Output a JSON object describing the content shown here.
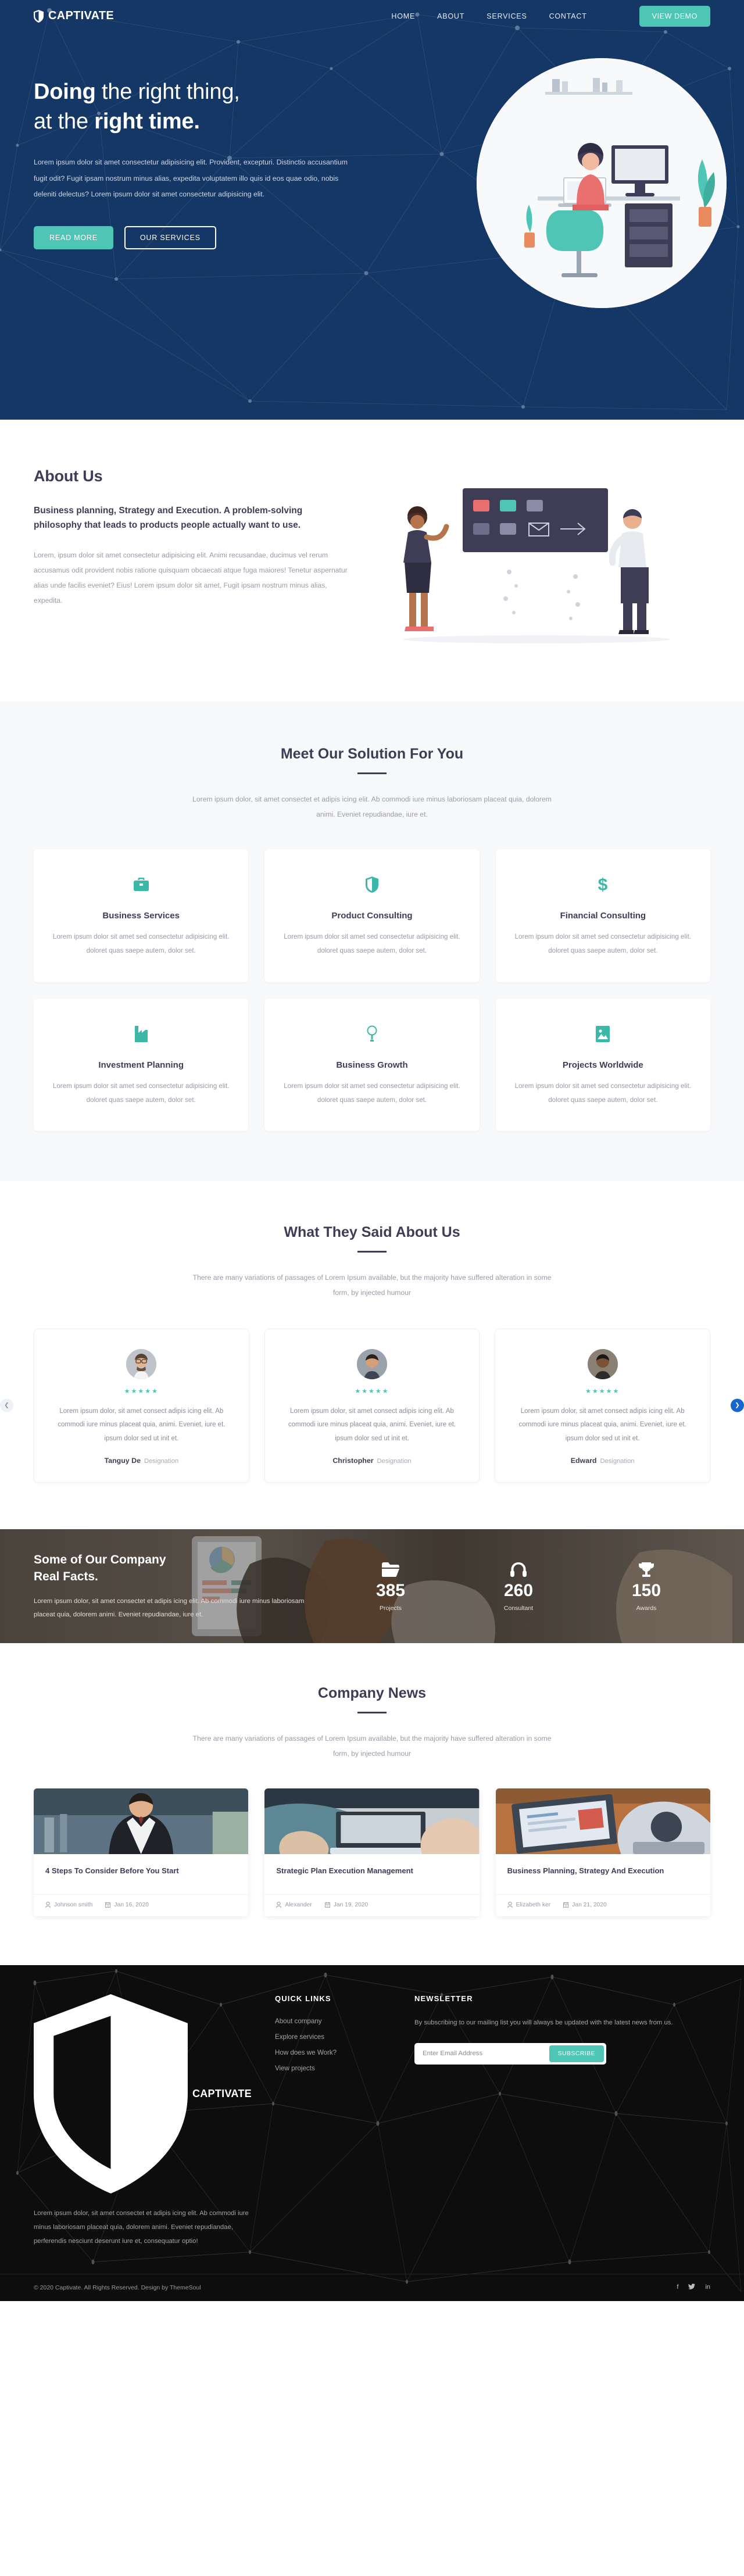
{
  "brand": {
    "name": "CAPTIVATE",
    "icon": "shield-icon"
  },
  "colors": {
    "accent": "#4ec5b5",
    "dark": "#3f3d56",
    "heroBg": "#153765",
    "footerBg": "#0d0d0d"
  },
  "nav": {
    "items": [
      {
        "label": "HOME"
      },
      {
        "label": "ABOUT"
      },
      {
        "label": "SERVICES"
      },
      {
        "label": "CONTACT"
      }
    ],
    "cta": "VIEW DEMO"
  },
  "hero": {
    "title_line1_bold": "Doing",
    "title_line1_rest": " the right thing,",
    "title_line2_rest": "at the ",
    "title_line2_bold": "right time.",
    "paragraph": "Lorem ipsum dolor sit amet consectetur adipisicing elit. Provident, excepturi. Distinctio accusantium fugit odit? Fugit ipsam nostrum minus alias, expedita voluptatem illo quis id eos quae odio, nobis deleniti delectus? Lorem ipsum dolor sit amet consectetur adipisicing elit.",
    "btn_primary": "READ MORE",
    "btn_secondary": "OUR SERVICES"
  },
  "about": {
    "heading": "About Us",
    "lead": "Business planning, Strategy and Execution. A problem-solving philosophy that leads to products people actually want to use.",
    "paragraph": "Lorem, ipsum dolor sit amet consectetur adipisicing elit. Animi recusandae, ducimus vel rerum accusamus odit provident nobis ratione quisquam obcaecati atque fuga maiores! Tenetur aspernatur alias unde facilis eveniet? Eius! Lorem ipsum dolor sit amet, Fugit ipsam nostrum minus alias, expedita."
  },
  "services": {
    "title": "Meet Our Solution For You",
    "subtitle": "Lorem ipsum dolor, sit amet consectet et adipis icing elit. Ab commodi iure minus laboriosam placeat quia, dolorem animi. Eveniet repudiandae, iure et.",
    "cards": [
      {
        "icon": "briefcase-icon",
        "title": "Business Services",
        "text": "Lorem ipsum dolor sit amet sed consectetur adipisicing elit. doloret quas saepe autem, dolor set."
      },
      {
        "icon": "shield-icon",
        "title": "Product Consulting",
        "text": "Lorem ipsum dolor sit amet sed consectetur adipisicing elit. doloret quas saepe autem, dolor set."
      },
      {
        "icon": "dollar-icon",
        "title": "Financial Consulting",
        "text": "Lorem ipsum dolor sit amet sed consectetur adipisicing elit. doloret quas saepe autem, dolor set."
      },
      {
        "icon": "factory-icon",
        "title": "Investment Planning",
        "text": "Lorem ipsum dolor sit amet sed consectetur adipisicing elit. doloret quas saepe autem, dolor set."
      },
      {
        "icon": "lightbulb-icon",
        "title": "Business Growth",
        "text": "Lorem ipsum dolor sit amet sed consectetur adipisicing elit. doloret quas saepe autem, dolor set."
      },
      {
        "icon": "image-icon",
        "title": "Projects Worldwide",
        "text": "Lorem ipsum dolor sit amet sed consectetur adipisicing elit. doloret quas saepe autem, dolor set."
      }
    ]
  },
  "testimonials": {
    "title": "What They Said About Us",
    "subtitle": "There are many variations of passages of Lorem Ipsum available, but the majority have suffered alteration in some form, by injected humour",
    "stars": "★★★★★",
    "prev": "❮",
    "next": "❯",
    "items": [
      {
        "quote": "Lorem ipsum dolor, sit amet consect adipis icing elit. Ab commodi iure minus placeat quia, animi. Eveniet, iure et. ipsum dolor sed ut init et.",
        "name": "Tanguy De",
        "role": "Designation"
      },
      {
        "quote": "Lorem ipsum dolor, sit amet consect adipis icing elit. Ab commodi iure minus placeat quia, animi. Eveniet, iure et. ipsum dolor sed ut init et.",
        "name": "Christopher",
        "role": "Designation"
      },
      {
        "quote": "Lorem ipsum dolor, sit amet consect adipis icing elit. Ab commodi iure minus placeat quia, animi. Eveniet, iure et. ipsum dolor sed ut init et.",
        "name": "Edward",
        "role": "Designation"
      }
    ]
  },
  "facts": {
    "heading_line1": "Some of Our Company",
    "heading_line2": "Real Facts.",
    "paragraph": "Lorem ipsum dolor, sit amet consectet et adipis icing elit. Ab commodi iure minus laboriosam placeat quia, dolorem animi. Eveniet repudiandae, iure et.",
    "stats": [
      {
        "icon": "folder-icon",
        "number": "385",
        "label": "Projects"
      },
      {
        "icon": "headset-icon",
        "number": "260",
        "label": "Consultant"
      },
      {
        "icon": "trophy-icon",
        "number": "150",
        "label": "Awards"
      }
    ]
  },
  "news": {
    "title": "Company News",
    "subtitle": "There are many variations of passages of Lorem Ipsum available, but the majority have suffered alteration in some form, by injected humour",
    "items": [
      {
        "title": "4 Steps To Consider Before You Start",
        "author": "Johnson smith",
        "date": "Jan 16, 2020",
        "thumb": "businessman-photo"
      },
      {
        "title": "Strategic Plan Execution Management",
        "author": "Alexander",
        "date": "Jan 19, 2020",
        "thumb": "laptop-hands-photo"
      },
      {
        "title": "Business Planning, Strategy And Execution",
        "author": "Elizabeth ker",
        "date": "Jan 21, 2020",
        "thumb": "desk-laptop-photo"
      }
    ]
  },
  "footer": {
    "about_text": "Lorem ipsum dolor, sit amet consectet et adipis icing elit. Ab commodi iure minus laboriosam placeat quia, dolorem animi. Eveniet repudiandae, perferendis nesciunt deserunt iure et, consequatur optio!",
    "quick_links_title": "QUICK LINKS",
    "quick_links": [
      {
        "label": "About company"
      },
      {
        "label": "Explore services"
      },
      {
        "label": "How does we Work?"
      },
      {
        "label": "View projects"
      }
    ],
    "newsletter_title": "NEWSLETTER",
    "newsletter_text": "By subscribing to our mailing list you will always be updated with the latest news from us.",
    "email_placeholder": "Enter Email Address",
    "email_value": "",
    "subscribe_label": "SUBSCRIBE",
    "copyright": "© 2020 Captivate. All Rights Reserved. Design by ThemeSoul",
    "socials": [
      {
        "icon": "facebook-icon",
        "glyph": "f"
      },
      {
        "icon": "twitter-icon",
        "glyph": "🐦"
      },
      {
        "icon": "linkedin-icon",
        "glyph": "in"
      }
    ]
  }
}
